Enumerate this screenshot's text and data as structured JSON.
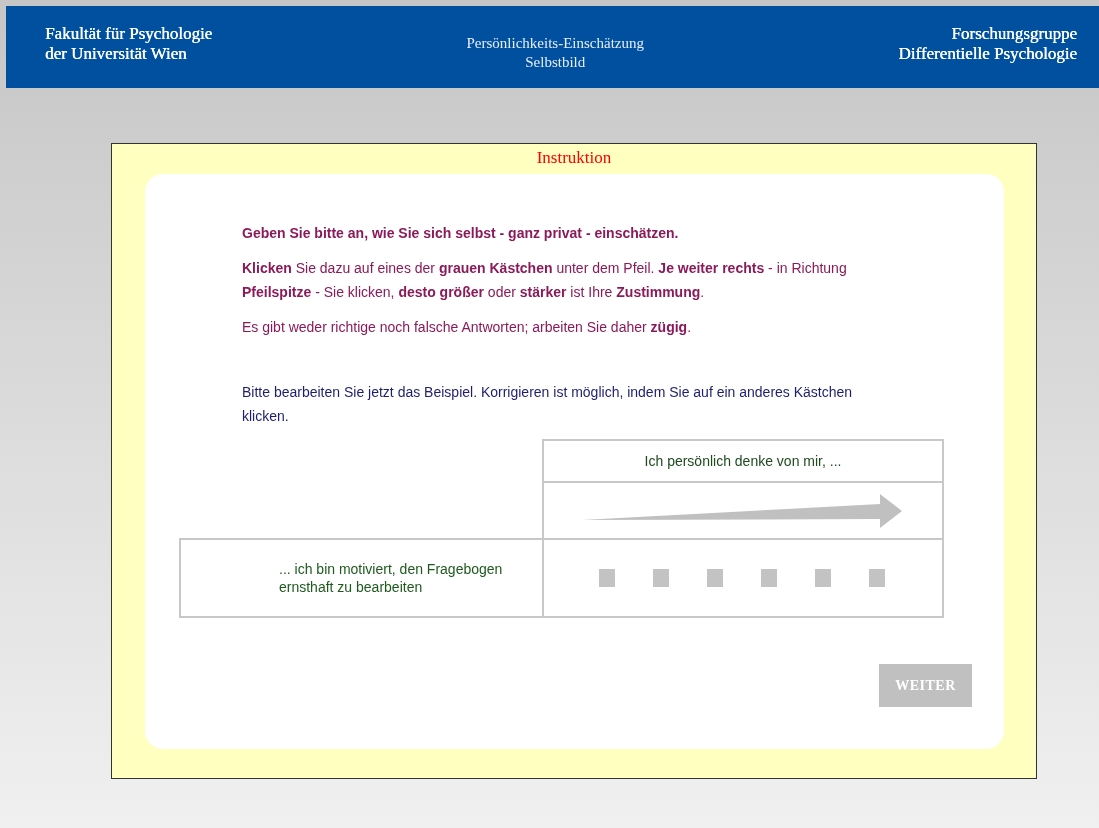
{
  "header": {
    "left": [
      "Fakultät für Psychologie",
      "der Universität Wien"
    ],
    "center": [
      "Persönlichkeits-Einschätzung",
      "Selbstbild"
    ],
    "right": [
      "Forschungsgruppe",
      "Differentielle Psychologie"
    ]
  },
  "panel": {
    "title": "Instruktion"
  },
  "paragraphs": [
    {
      "kind": "lead",
      "text": "Geben Sie bitte an, wie Sie sich selbst - ganz privat - einschätzen."
    },
    {
      "kind": "body",
      "text": "**Klicken** Sie dazu auf eines der **grauen Kästchen** unter dem Pfeil. **Je weiter rechts** - in Richtung **Pfeilspitze** - Sie klicken, **desto größer** oder **stärker** ist Ihre **Zustimmung**."
    },
    {
      "kind": "body",
      "text": "Es gibt weder richtige noch falsche Antworten; arbeiten Sie daher **zügig**."
    },
    {
      "kind": "note",
      "text": "Bitte bearbeiten Sie jetzt das Beispiel. Korrigieren ist möglich, indem Sie auf ein anderes Kästchen klicken."
    }
  ],
  "scale": {
    "heading": "Ich persönlich denke von mir, ...",
    "item": "... ich bin motiviert, den Fragebogen ernsthaft zu bearbeiten",
    "options": [
      {
        "selected": false
      },
      {
        "selected": false
      },
      {
        "selected": false
      },
      {
        "selected": false
      },
      {
        "selected": false
      },
      {
        "selected": false
      }
    ]
  },
  "next_button": {
    "label": "WEITER",
    "disabled": true
  }
}
